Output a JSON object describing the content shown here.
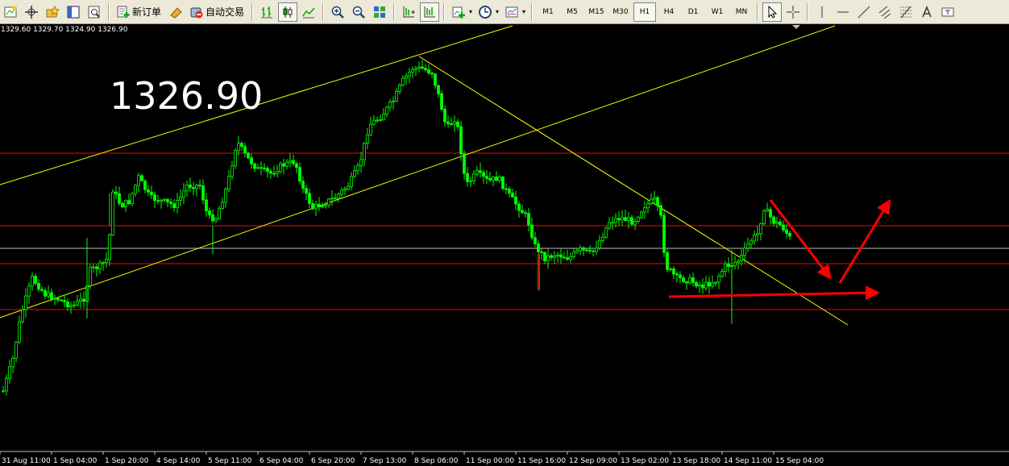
{
  "toolbar": {
    "new_order_label": "新订单",
    "auto_trading_label": "自动交易",
    "timeframes": [
      "M1",
      "M5",
      "M15",
      "M30",
      "H1",
      "H4",
      "D1",
      "W1",
      "MN"
    ],
    "active_timeframe": "H1"
  },
  "chart": {
    "ohlc_text": "1329.60 1329.70 1324.90 1326.90",
    "big_price": "1326.90",
    "x_labels": [
      "31 Aug 11:00",
      "1 Sep 04:00",
      "1 Sep 20:00",
      "4 Sep 14:00",
      "5 Sep 11:00",
      "6 Sep 04:00",
      "6 Sep 20:00",
      "7 Sep 13:00",
      "8 Sep 06:00",
      "11 Sep 00:00",
      "11 Sep 16:00",
      "12 Sep 09:00",
      "13 Sep 02:00",
      "13 Sep 18:00",
      "14 Sep 11:00",
      "15 Sep 04:00"
    ],
    "colors": {
      "background": "#000000",
      "bull": "#00ff00",
      "bear": "#00ff00",
      "trendline": "#ffff00",
      "level": "#ff0000",
      "bid_line": "#c0c0c0",
      "annotation": "#ff0000"
    }
  }
}
